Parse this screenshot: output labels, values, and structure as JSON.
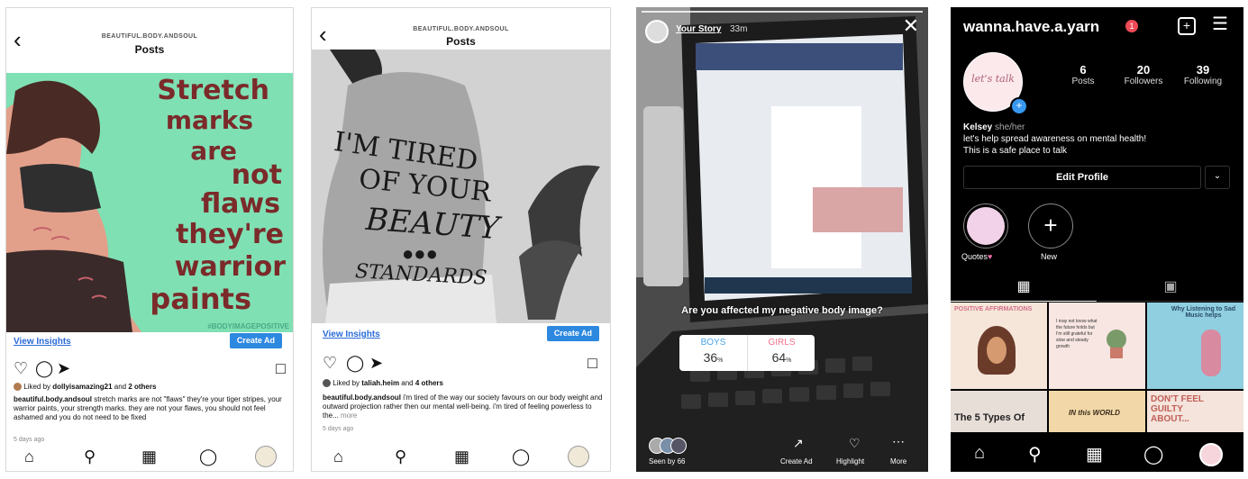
{
  "panel1": {
    "account": "BEAUTIFUL.BODY.ANDSOUL",
    "title": "Posts",
    "poster_lines": [
      "Stretch",
      "marks",
      "are",
      "not",
      "flaws",
      "they're",
      "warrior",
      "paints"
    ],
    "hashtag": "#BODYIMAGEPOSITIVE",
    "view_insights": "View Insights",
    "create_ad": "Create Ad",
    "liked_prefix": "Liked by ",
    "liked_user": "dollyisamazing21",
    "liked_mid": " and ",
    "liked_others": "2 others",
    "caption_user": "beautiful.body.andsoul",
    "caption_text": " stretch marks are not \"flaws\" they're your tiger stripes, your warrior paints, your strength marks. they are not your flaws, you should not feel ashamed and you do not need to be fixed",
    "time": "5 days ago"
  },
  "panel2": {
    "account": "BEAUTIFUL.BODY.ANDSOUL",
    "title": "Posts",
    "back_lines": [
      "I'M TIRED",
      "OF YOUR",
      "BEAUTY",
      "STANDARDS"
    ],
    "view_insights": "View Insights",
    "create_ad": "Create Ad",
    "liked_prefix": "Liked by ",
    "liked_user": "taliah.heim",
    "liked_mid": " and ",
    "liked_others": "4 others",
    "caption_user": "beautiful.body.andsoul",
    "caption_text": " i'm tired of the way our society favours on our body weight and outward projection rather then our mental well-being. i'm tired of feeling powerless to the...",
    "more": "more",
    "time": "5 days ago"
  },
  "panel3": {
    "story_label": "Your Story",
    "story_time": "33m",
    "question": "Are you affected my negative body image?",
    "opt1_label": "BOYS",
    "opt1_pct": "36",
    "opt2_label": "GIRLS",
    "opt2_pct": "64",
    "pct_sign": "%",
    "seen_by": "Seen by 66",
    "create_ad": "Create Ad",
    "highlight": "Highlight",
    "more": "More",
    "opt1_value": 0.36,
    "opt2_value": 0.64
  },
  "panel4": {
    "username": "wanna.have.a.yarn",
    "notif": "1",
    "avatar_text": "let's talk",
    "posts_count": "6",
    "posts_label": "Posts",
    "followers_count": "20",
    "followers_label": "Followers",
    "following_count": "39",
    "following_label": "Following",
    "name": "Kelsey",
    "pronouns": "she/her",
    "bio1": "let's help spread awareness on mental health!",
    "bio2": "This is a safe place to talk",
    "edit_profile": "Edit Profile",
    "hl1_label": "Quotes",
    "hl2_label": "New",
    "tile1_title": "POSITIVE AFFIRMATIONS",
    "tile2_text": "I may not know what the future holds but I'm still grateful for slow and steady growth",
    "tile3_title": "Why Listening to Sad Music helps",
    "tile4_title": "The 5 Types Of",
    "tile5_text": "IN this WORLD",
    "tile6_title": "DON'T FEEL GUILTY ABOUT..."
  },
  "colors": {
    "accent_blue": "#2d88e0",
    "link_blue": "#2a6ad8",
    "poster_green": "#7fe0b4",
    "poster_red": "#7b2a2a",
    "notif_red": "#ed4956",
    "boys_blue": "#4aa3e8",
    "girls_pink": "#f0708c"
  }
}
